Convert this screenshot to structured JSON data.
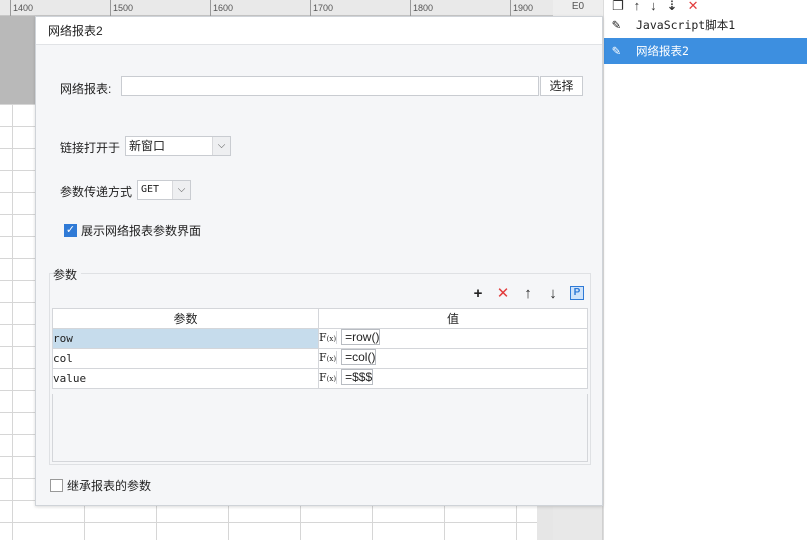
{
  "ruler": {
    "ticks": [
      "1400",
      "1500",
      "1600",
      "1700",
      "1800",
      "1900"
    ]
  },
  "corner_icon": "E0",
  "right_panel": {
    "toolbar_icons": [
      "copy-icon",
      "arrow-up-icon",
      "arrow-down-icon",
      "move-down-icon",
      "delete-icon"
    ],
    "items": [
      {
        "label": "JavaScript脚本1",
        "selected": false
      },
      {
        "label": "网络报表2",
        "selected": true
      }
    ]
  },
  "dialog": {
    "title": "网络报表2",
    "report_label": "网络报表:",
    "report_value": "",
    "choose_button": "选择",
    "link_open_label": "链接打开于",
    "link_open_value": "新窗口",
    "param_method_label": "参数传递方式",
    "param_method_value": "GET",
    "show_params_label": "展示网络报表参数界面",
    "show_params_checked": true,
    "params_group_label": "参数",
    "params_table": {
      "headers": [
        "参数",
        "值"
      ],
      "rows": [
        {
          "name": "row",
          "value": "=row()",
          "selected": true
        },
        {
          "name": "col",
          "value": "=col()",
          "selected": false
        },
        {
          "name": "value",
          "value": "=$$$",
          "selected": false
        }
      ]
    },
    "inherit_label": "继承报表的参数",
    "inherit_checked": false
  }
}
